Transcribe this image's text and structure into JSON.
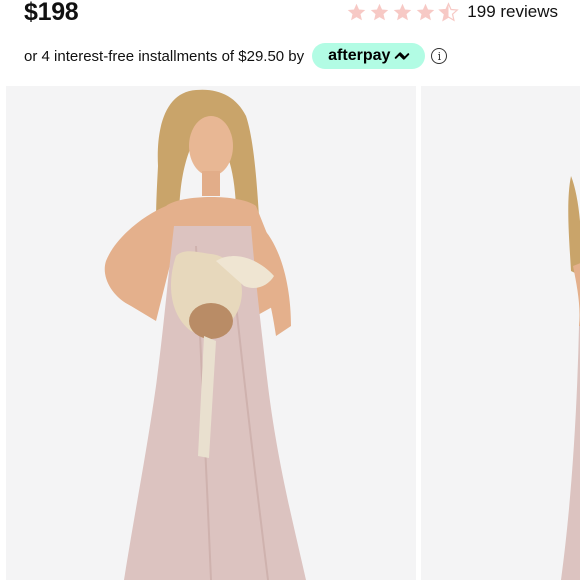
{
  "product": {
    "price": "$198",
    "rating": {
      "stars_value": 4.5,
      "stars_max": 5,
      "star_color": "#f7c9c5",
      "reviews_text": "199 reviews"
    }
  },
  "payment": {
    "installments_text": "or 4 interest-free installments of $29.50 by",
    "provider_label": "afterpay",
    "badge_color": "#b2fce4",
    "info_icon": "info-icon"
  },
  "gallery": {
    "images": [
      {
        "name": "model-front-photo",
        "dress_color": "#dcc3c0"
      },
      {
        "name": "model-side-photo-partial",
        "dress_color": "#dcc3c0"
      }
    ]
  }
}
